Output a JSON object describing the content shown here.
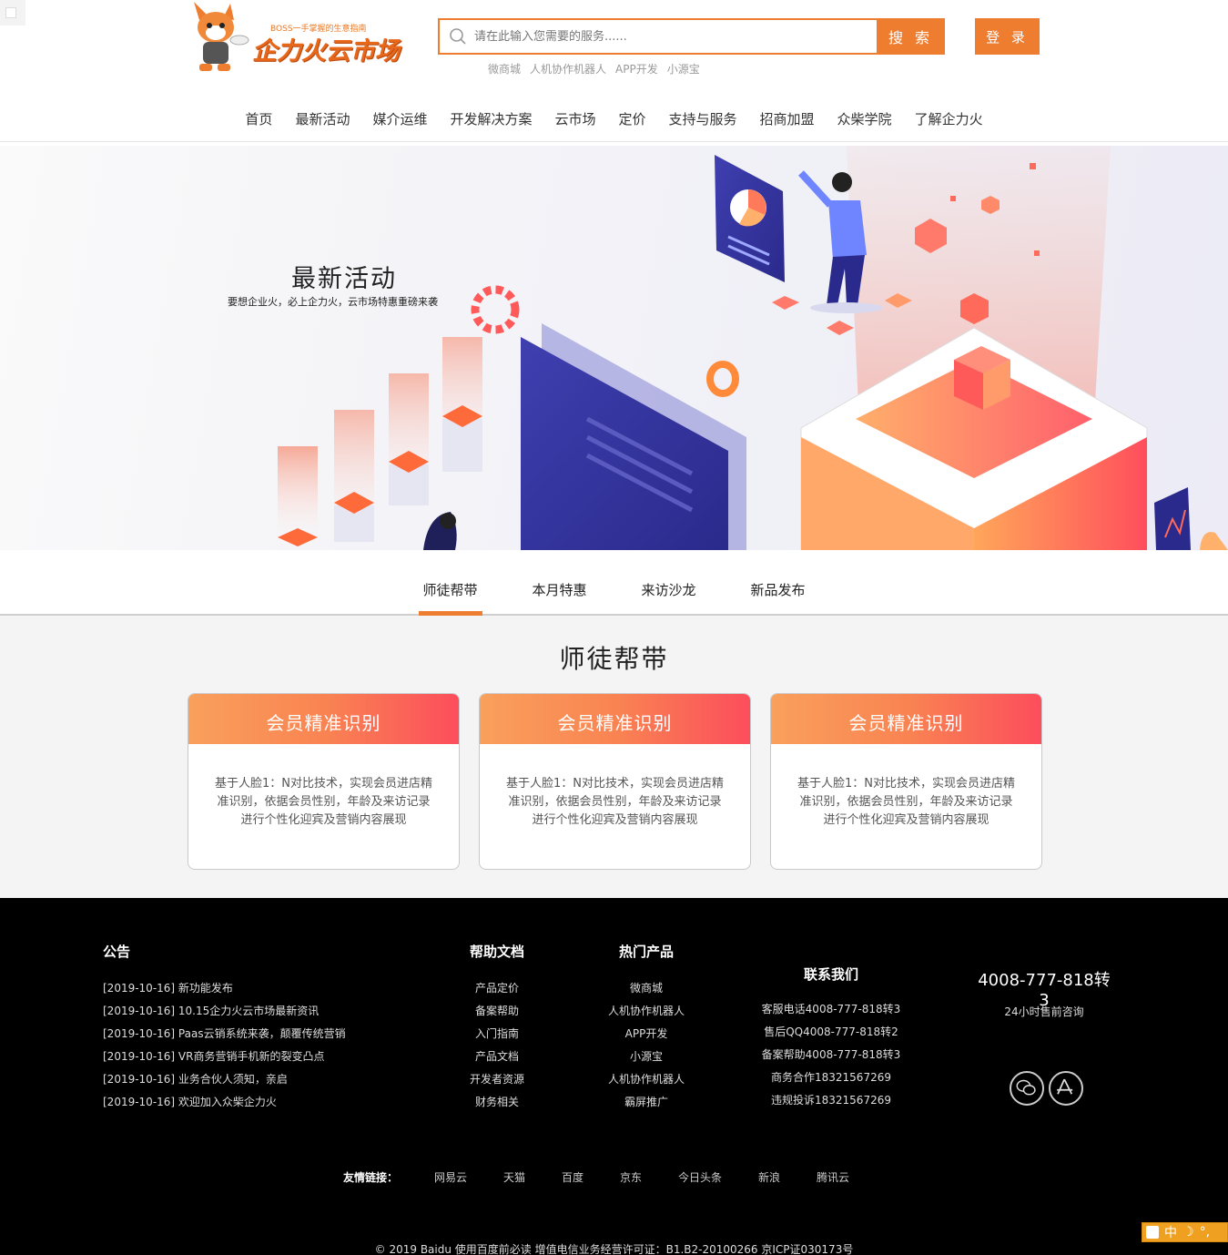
{
  "header": {
    "logo_slogan": "BOSS一手掌握的生意指南",
    "logo_text": "企力火云市场",
    "search_placeholder": "请在此输入您需要的服务......",
    "search_button": "搜 索",
    "hot_links": [
      "微商城",
      "人机协作机器人",
      "APP开发",
      "小源宝"
    ],
    "login_button": "登 录"
  },
  "nav": {
    "items": [
      "首页",
      "最新活动",
      "媒介运维",
      "开发解决方案",
      "云市场",
      "定价",
      "支持与服务",
      "招商加盟",
      "众柴学院",
      "了解企力火"
    ]
  },
  "banner": {
    "title": "最新活动",
    "subtitle": "要想企业火，必上企力火，云市场特惠重磅来袭"
  },
  "tabs": {
    "items": [
      "师徒帮带",
      "本月特惠",
      "来访沙龙",
      "新品发布"
    ],
    "active_index": 0
  },
  "section": {
    "title": "师徒帮带",
    "cards": [
      {
        "title": "会员精准识别",
        "desc": "基于人脸1：N对比技术，实现会员进店精准识别，依据会员性别，年龄及来访记录进行个性化迎宾及营销内容展现"
      },
      {
        "title": "会员精准识别",
        "desc": "基于人脸1：N对比技术，实现会员进店精准识别，依据会员性别，年龄及来访记录进行个性化迎宾及营销内容展现"
      },
      {
        "title": "会员精准识别",
        "desc": "基于人脸1：N对比技术，实现会员进店精准识别，依据会员性别，年龄及来访记录进行个性化迎宾及营销内容展现"
      }
    ]
  },
  "footer": {
    "notice": {
      "title": "公告",
      "items": [
        "[2019-10-16] 新功能发布",
        "[2019-10-16] 10.15企力火云市场最新资讯",
        "[2019-10-16] Paas云销系统来袭，颠覆传统营销",
        "[2019-10-16] VR商务营销手机新的裂变凸点",
        "[2019-10-16] 业务合伙人须知，亲启",
        "[2019-10-16] 欢迎加入众柴企力火"
      ]
    },
    "help": {
      "title": "帮助文档",
      "items": [
        "产品定价",
        "备案帮助",
        "入门指南",
        "产品文档",
        "开发者资源",
        "财务相关"
      ]
    },
    "hot": {
      "title": "热门产品",
      "items": [
        "微商城",
        "人机协作机器人",
        "APP开发",
        "小源宝",
        "人机协作机器人",
        "霸屏推广"
      ]
    },
    "contact": {
      "title": "联系我们",
      "items": [
        "客服电话4008-777-818转3",
        "售后QQ4008-777-818转2",
        "备案帮助4008-777-818转3",
        "商务合作18321567269",
        "违规投诉18321567269"
      ]
    },
    "phone": "4008-777-818转3",
    "phone_sub": "24小时售前咨询",
    "icons": [
      "wechat-icon",
      "app-store-icon"
    ],
    "friend_links_label": "友情链接：",
    "friend_links": [
      "网易云",
      "天猫",
      "百度",
      "京东",
      "今日头条",
      "新浪",
      "腾讯云"
    ],
    "copyright": "© 2019 Baidu 使用百度前必读 增值电信业务经营许可证：B1.B2-20100266 京ICP证030173号",
    "ime": "中"
  }
}
